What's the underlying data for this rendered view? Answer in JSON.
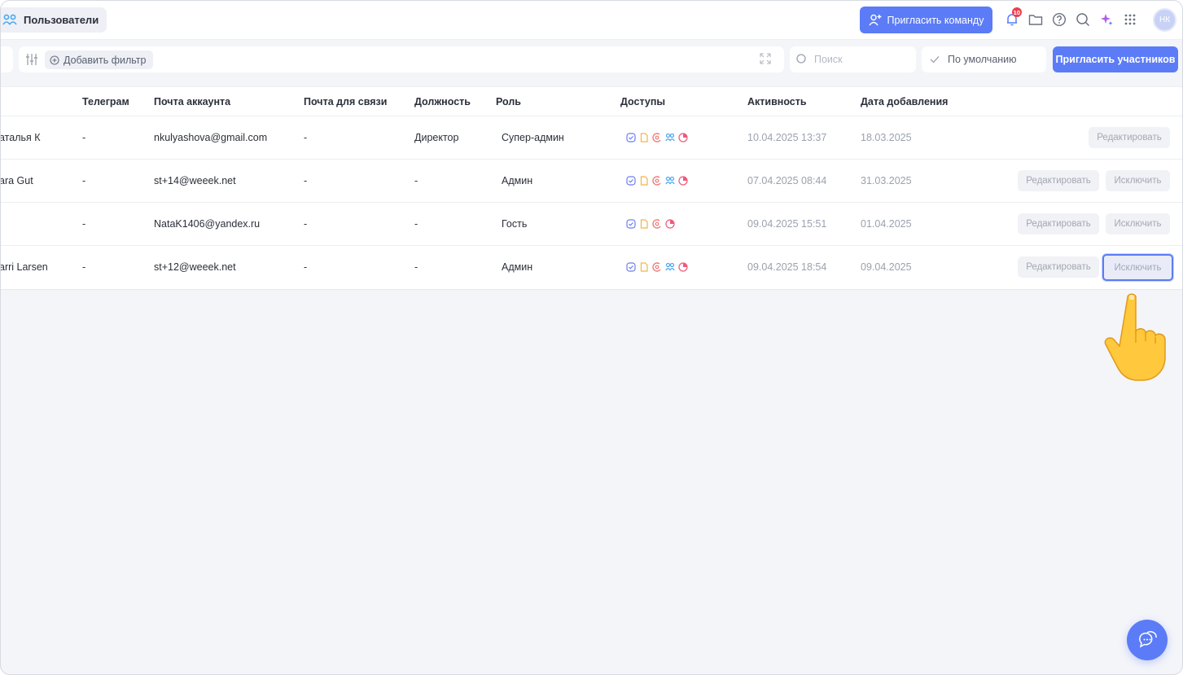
{
  "header": {
    "page_title": "Пользователи",
    "invite_team_label": "Пригласить команду",
    "notifications_count": "10",
    "avatar_initials": "НК"
  },
  "filters": {
    "add_filter_label": "Добавить фильтр",
    "search_placeholder": "Поиск",
    "sort_label": "По умолчанию",
    "invite_members_label": "Пригласить участников"
  },
  "table": {
    "columns": [
      "Телеграм",
      "Почта аккаунта",
      "Почта для связи",
      "Должность",
      "Роль",
      "Доступы",
      "Активность",
      "Дата добавления"
    ],
    "rows": [
      {
        "name": "аталья К",
        "telegram": "-",
        "account_email": "nkulyashova@gmail.com",
        "contact_email": "-",
        "position": "Директор",
        "role": "Супер-админ",
        "access": [
          "tasks",
          "docs",
          "crm",
          "users",
          "analytics"
        ],
        "activity": "10.04.2025 13:37",
        "added": "18.03.2025",
        "edit_label": "Редактировать",
        "exclude_label": ""
      },
      {
        "name": "ara Gut",
        "telegram": "-",
        "account_email": "st+14@weeek.net",
        "contact_email": "-",
        "position": "-",
        "role": "Админ",
        "access": [
          "tasks",
          "docs",
          "crm",
          "users",
          "analytics"
        ],
        "activity": "07.04.2025 08:44",
        "added": "31.03.2025",
        "edit_label": "Редактировать",
        "exclude_label": "Исключить"
      },
      {
        "name": "",
        "telegram": "-",
        "account_email": "NataK1406@yandex.ru",
        "contact_email": "-",
        "position": "-",
        "role": "Гость",
        "access": [
          "tasks",
          "docs",
          "crm",
          "analytics"
        ],
        "activity": "09.04.2025 15:51",
        "added": "01.04.2025",
        "edit_label": "Редактировать",
        "exclude_label": "Исключить"
      },
      {
        "name": "arri Larsen",
        "telegram": "-",
        "account_email": "st+12@weeek.net",
        "contact_email": "-",
        "position": "-",
        "role": "Админ",
        "access": [
          "tasks",
          "docs",
          "crm",
          "users",
          "analytics"
        ],
        "activity": "09.04.2025 18:54",
        "added": "09.04.2025",
        "edit_label": "Редактировать",
        "exclude_label": "Исключить"
      }
    ]
  },
  "colors": {
    "accent": "#5b7cf6",
    "badge": "#ef3f4d",
    "access_tasks": "#6a7ef0",
    "access_docs": "#f3b44a",
    "access_crm": "#f07a7a",
    "access_users": "#4aa6f0",
    "access_analytics": "#ef5a7a"
  }
}
